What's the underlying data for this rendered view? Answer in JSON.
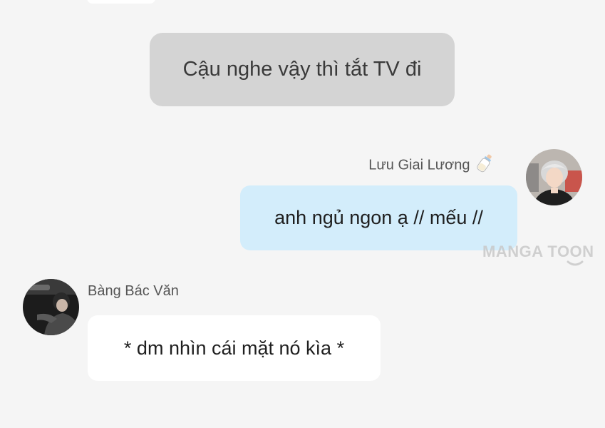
{
  "conversation": {
    "narration": "Cậu nghe vậy thì tắt TV đi",
    "messages": [
      {
        "side": "right",
        "sender": "Lưu Giai Lương",
        "sender_icon": "baby-bottle-icon",
        "text": "anh ngủ ngon ạ // mếu //",
        "bubble_color": "#d3edfb"
      },
      {
        "side": "left",
        "sender": "Bàng Bác Văn",
        "text": "* dm nhìn cái mặt nó kìa *",
        "bubble_color": "#ffffff"
      }
    ]
  },
  "watermark": {
    "text": "MANGA TOON"
  },
  "colors": {
    "background": "#f5f5f5",
    "narration_bubble": "#d4d4d4"
  }
}
